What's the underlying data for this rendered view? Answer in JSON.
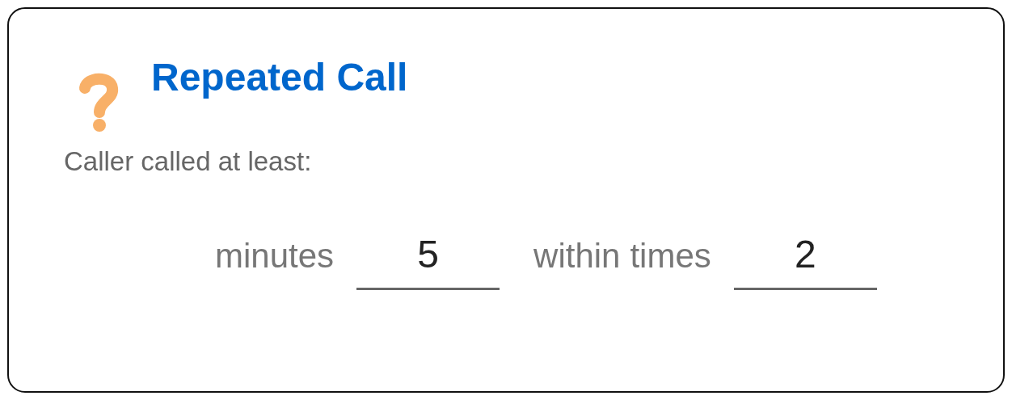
{
  "card": {
    "title": "Repeated Call",
    "description": "Caller called at least:",
    "row": [
      {
        "kind": "label",
        "text": "minutes"
      },
      {
        "kind": "field",
        "value": "5"
      },
      {
        "kind": "label",
        "text": "within"
      },
      {
        "kind": "label",
        "text": "times"
      },
      {
        "kind": "field",
        "value": "2"
      }
    ]
  }
}
